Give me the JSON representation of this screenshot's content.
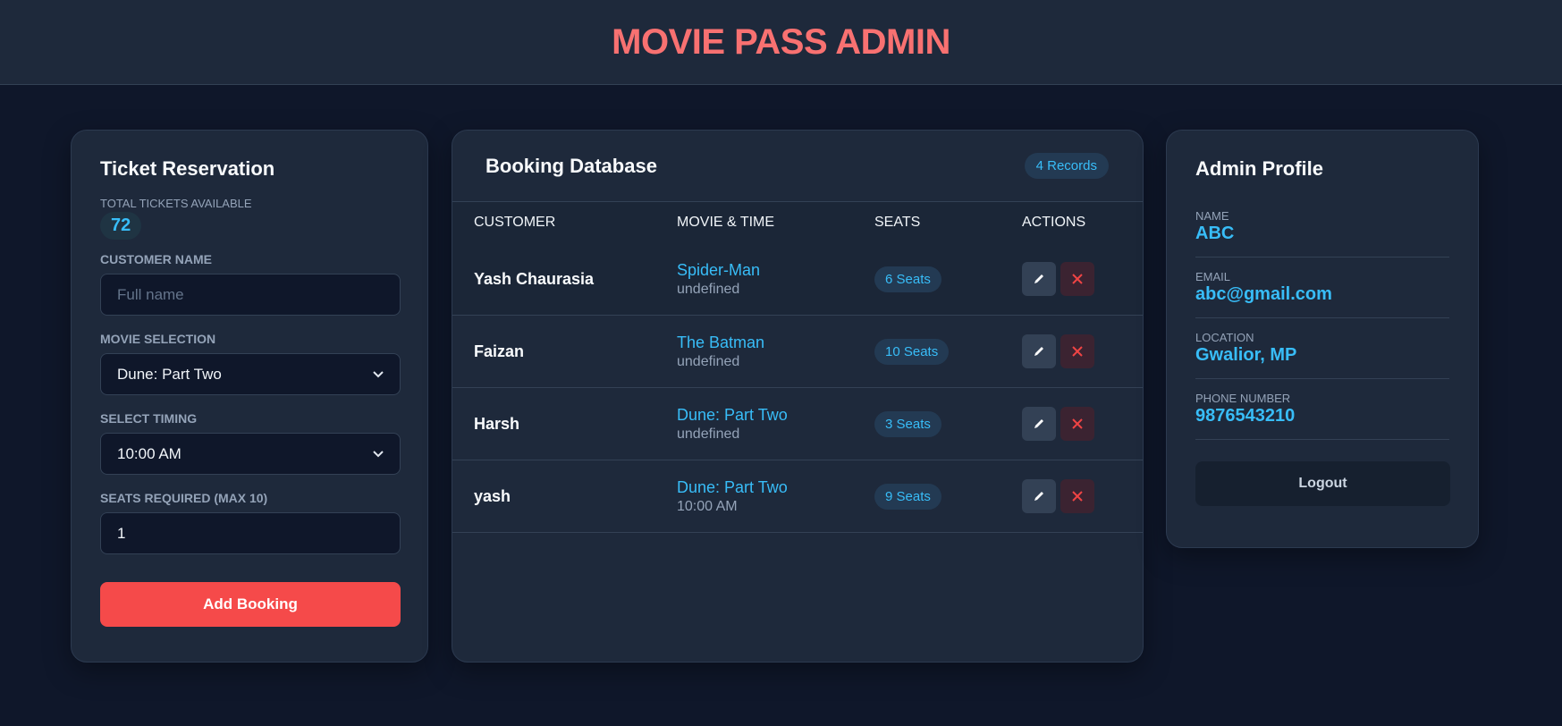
{
  "header": {
    "title": "MOVIE PASS ADMIN"
  },
  "reservation": {
    "title": "Ticket Reservation",
    "available_label": "TOTAL TICKETS AVAILABLE",
    "available_count": "72",
    "customer_label": "CUSTOMER NAME",
    "customer_placeholder": "Full name",
    "movie_label": "MOVIE SELECTION",
    "movie_value": "Dune: Part Two",
    "timing_label": "SELECT TIMING",
    "timing_value": "10:00 AM",
    "seats_label": "SEATS REQUIRED (MAX 10)",
    "seats_value": "1",
    "add_button": "Add Booking"
  },
  "database": {
    "title": "Booking Database",
    "records": "4 Records",
    "columns": [
      "CUSTOMER",
      "MOVIE & TIME",
      "SEATS",
      "ACTIONS"
    ],
    "rows": [
      {
        "customer": "Yash Chaurasia",
        "movie": "Spider-Man",
        "time": "undefined",
        "seats": "6 Seats"
      },
      {
        "customer": "Faizan",
        "movie": "The Batman",
        "time": "undefined",
        "seats": "10 Seats"
      },
      {
        "customer": "Harsh",
        "movie": "Dune: Part Two",
        "time": "undefined",
        "seats": "3 Seats"
      },
      {
        "customer": "yash",
        "movie": "Dune: Part Two",
        "time": "10:00 AM",
        "seats": "9 Seats"
      }
    ]
  },
  "profile": {
    "title": "Admin Profile",
    "name_label": "NAME",
    "name": "ABC",
    "email_label": "EMAIL",
    "email": "abc@gmail.com",
    "location_label": "LOCATION",
    "location": "Gwalior, MP",
    "phone_label": "PHONE NUMBER",
    "phone": "9876543210",
    "logout": "Logout"
  },
  "icons": {
    "edit": "pencil-icon",
    "delete": "close-icon",
    "dropdown": "chevron-down-icon"
  },
  "colors": {
    "accent": "#38bdf8",
    "danger": "#f54a4a",
    "title": "#f87171",
    "background": "#0f172a",
    "card": "#1e293b"
  }
}
